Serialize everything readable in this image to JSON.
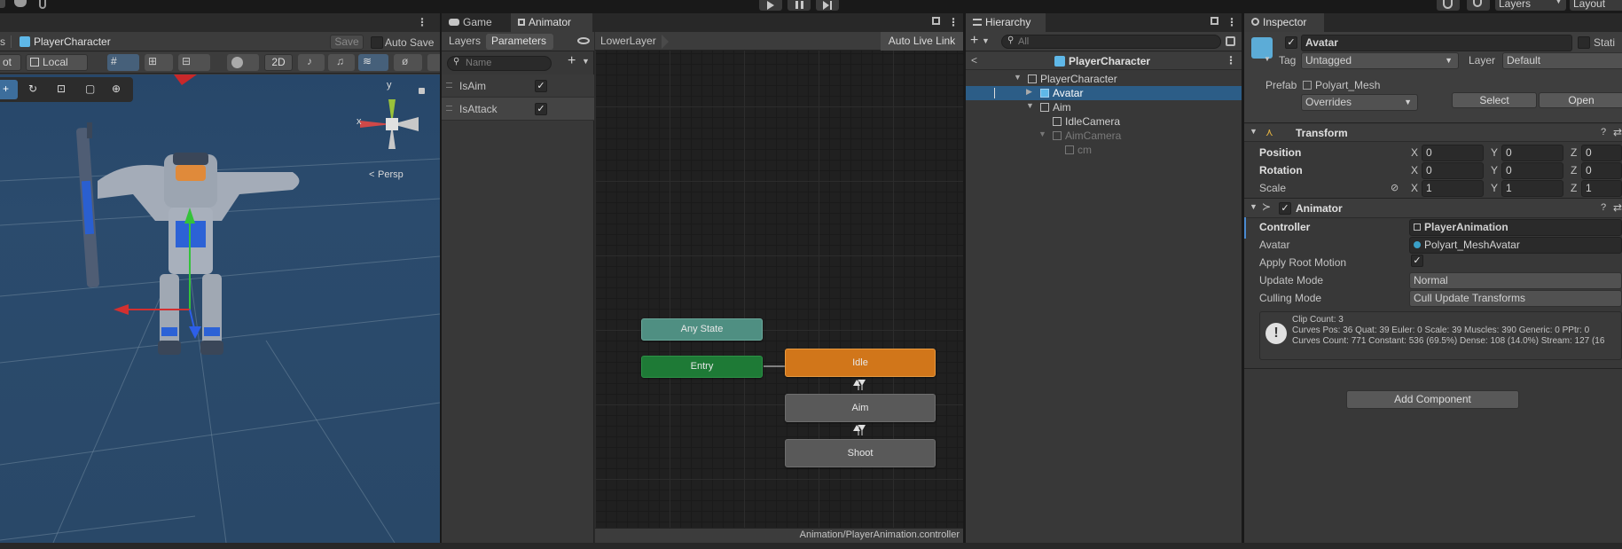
{
  "top_toolbar": {
    "play_icon": "play-icon",
    "pause_icon": "pause-icon",
    "step_icon": "step-icon",
    "layers_label": "Layers",
    "layout_label": "Layout"
  },
  "scene": {
    "tab_label": "s",
    "object_name": "PlayerCharacter",
    "save_label": "Save",
    "auto_save_label": "Auto Save",
    "pivot_label": "ot",
    "local_label": "Local",
    "mode_2d": "2D",
    "persp_label": "Persp",
    "gizmo_x": "x",
    "gizmo_y": "y"
  },
  "animator": {
    "tabs": [
      "Game",
      "Animator"
    ],
    "subtabs": [
      "Layers",
      "Parameters"
    ],
    "layer_name": "LowerLayer",
    "auto_live_link": "Auto Live Link",
    "search_placeholder": "Name",
    "parameters": [
      {
        "name": "IsAim",
        "value": true
      },
      {
        "name": "IsAttack",
        "value": true
      }
    ],
    "nodes": {
      "any_state": "Any State",
      "entry": "Entry",
      "idle": "Idle",
      "aim": "Aim",
      "shoot": "Shoot"
    },
    "footer_path": "Animation/PlayerAnimation.controller",
    "colors": {
      "any_state": "#4f8f82",
      "entry": "#1e7a36",
      "idle": "#d1761a",
      "state": "#5a5a5a"
    }
  },
  "hierarchy": {
    "tab_label": "Hierarchy",
    "search_placeholder": "All",
    "root_title": "PlayerCharacter",
    "items": [
      {
        "label": "PlayerCharacter",
        "indent": 0,
        "selected": false,
        "dim": false
      },
      {
        "label": "Avatar",
        "indent": 1,
        "selected": true,
        "dim": false
      },
      {
        "label": "Aim",
        "indent": 1,
        "selected": false,
        "dim": false
      },
      {
        "label": "IdleCamera",
        "indent": 2,
        "selected": false,
        "dim": false
      },
      {
        "label": "AimCamera",
        "indent": 2,
        "selected": false,
        "dim": true
      },
      {
        "label": "cm",
        "indent": 3,
        "selected": false,
        "dim": true
      }
    ]
  },
  "inspector": {
    "tab_label": "Inspector",
    "object_name": "Avatar",
    "static_label": "Stati",
    "tag_label": "Tag",
    "tag_value": "Untagged",
    "layer_label": "Layer",
    "layer_value": "Default",
    "prefab_label": "Prefab",
    "prefab_value": "Polyart_Mesh",
    "overrides_label": "Overrides",
    "select_label": "Select",
    "open_label": "Open",
    "transform": {
      "title": "Transform",
      "rows": [
        {
          "label": "Position",
          "x": "0",
          "y": "0",
          "z": "0"
        },
        {
          "label": "Rotation",
          "x": "0",
          "y": "0",
          "z": "0"
        },
        {
          "label": "Scale",
          "x": "1",
          "y": "1",
          "z": "1"
        }
      ],
      "axis_x": "X",
      "axis_y": "Y",
      "axis_z": "Z"
    },
    "animator_comp": {
      "title": "Animator",
      "controller_label": "Controller",
      "controller_value": "PlayerAnimation",
      "avatar_label": "Avatar",
      "avatar_value": "Polyart_MeshAvatar",
      "apply_root_label": "Apply Root Motion",
      "update_mode_label": "Update Mode",
      "update_mode_value": "Normal",
      "culling_label": "Culling Mode",
      "culling_value": "Cull Update Transforms",
      "info_lines": [
        "Clip Count: 3",
        "Curves Pos: 36 Quat: 39 Euler: 0 Scale: 39 Muscles: 390 Generic: 0 PPtr: 0",
        "Curves Count: 771 Constant: 536 (69.5%) Dense: 108 (14.0%) Stream: 127 (16"
      ]
    },
    "add_component": "Add Component"
  }
}
